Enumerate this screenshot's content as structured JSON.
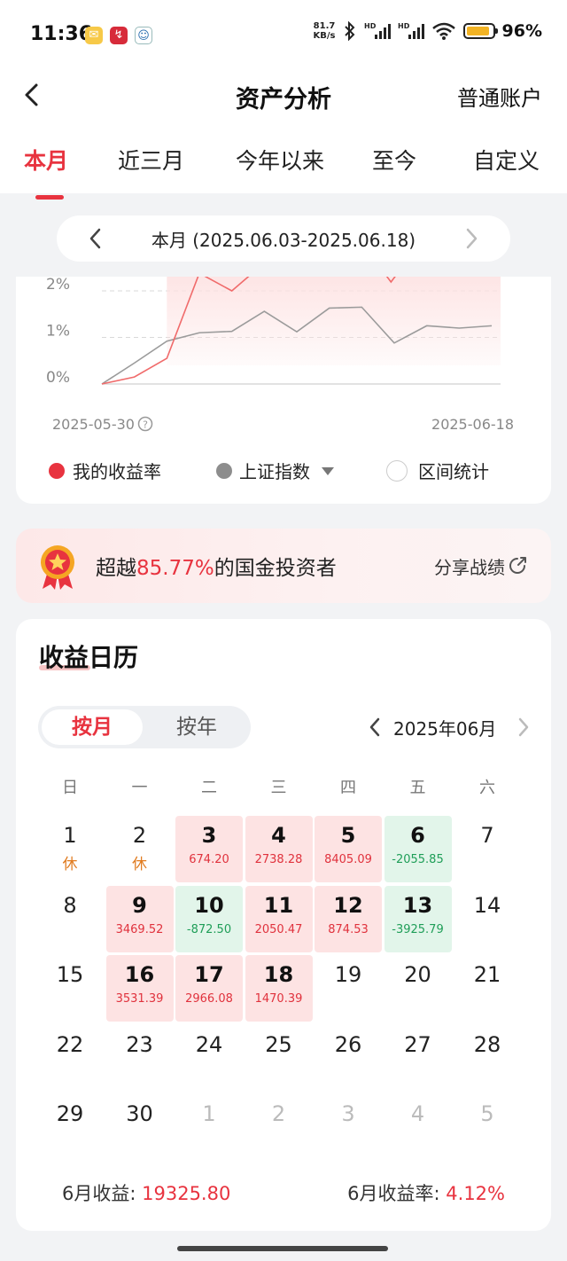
{
  "status_bar": {
    "time": "11:36",
    "net_speed_value": "81.7",
    "net_speed_unit": "KB/s",
    "battery_percent": "96",
    "battery_label": "96%"
  },
  "header": {
    "title": "资产分析",
    "account": "普通账户"
  },
  "tabs": [
    {
      "label": "本月",
      "active": true
    },
    {
      "label": "近三月"
    },
    {
      "label": "今年以来"
    },
    {
      "label": "至今"
    },
    {
      "label": "自定义"
    }
  ],
  "range": {
    "label": "本月 (2025.06.03-2025.06.18)"
  },
  "chart_data": {
    "type": "line",
    "y_ticks": [
      "2%",
      "1%",
      "0%"
    ],
    "x_start_label": "2025-05-30",
    "x_end_label": "2025-06-18",
    "series": [
      {
        "name": "我的收益率",
        "color": "#e8333f",
        "values": [
          0,
          0.15,
          0.55,
          2.38,
          2.0,
          2.6
        ]
      },
      {
        "name": "上证指数",
        "color": "#999999",
        "values": [
          0,
          0.45,
          0.92,
          1.1,
          1.13,
          1.56,
          1.12,
          1.63,
          1.65,
          0.88,
          1.25,
          1.2,
          1.25
        ]
      }
    ],
    "grid": true
  },
  "legend": {
    "mine": "我的收益率",
    "index": "上证指数",
    "stats": "区间统计"
  },
  "beat": {
    "prefix": "超越",
    "percent": "85.77%",
    "suffix": "的国金投资者",
    "share": "分享战绩"
  },
  "calendar": {
    "title": "收益日历",
    "seg_month": "按月",
    "seg_year": "按年",
    "month_label": "2025年06月",
    "weekdays": [
      "日",
      "一",
      "二",
      "三",
      "四",
      "五",
      "六"
    ],
    "cells": [
      {
        "day": "1",
        "sub": "休",
        "kind": "rest"
      },
      {
        "day": "2",
        "sub": "休",
        "kind": "rest"
      },
      {
        "day": "3",
        "sub": "674.20",
        "kind": "up"
      },
      {
        "day": "4",
        "sub": "2738.28",
        "kind": "up"
      },
      {
        "day": "5",
        "sub": "8405.09",
        "kind": "up"
      },
      {
        "day": "6",
        "sub": "-2055.85",
        "kind": "down"
      },
      {
        "day": "7",
        "sub": "",
        "kind": "plain"
      },
      {
        "day": "8",
        "sub": "",
        "kind": "plain"
      },
      {
        "day": "9",
        "sub": "3469.52",
        "kind": "up"
      },
      {
        "day": "10",
        "sub": "-872.50",
        "kind": "down"
      },
      {
        "day": "11",
        "sub": "2050.47",
        "kind": "up"
      },
      {
        "day": "12",
        "sub": "874.53",
        "kind": "up"
      },
      {
        "day": "13",
        "sub": "-3925.79",
        "kind": "down"
      },
      {
        "day": "14",
        "sub": "",
        "kind": "plain"
      },
      {
        "day": "15",
        "sub": "",
        "kind": "plain"
      },
      {
        "day": "16",
        "sub": "3531.39",
        "kind": "up"
      },
      {
        "day": "17",
        "sub": "2966.08",
        "kind": "up"
      },
      {
        "day": "18",
        "sub": "1470.39",
        "kind": "up"
      },
      {
        "day": "19",
        "sub": "",
        "kind": "plain"
      },
      {
        "day": "20",
        "sub": "",
        "kind": "plain"
      },
      {
        "day": "21",
        "sub": "",
        "kind": "plain"
      },
      {
        "day": "22",
        "sub": "",
        "kind": "plain"
      },
      {
        "day": "23",
        "sub": "",
        "kind": "plain"
      },
      {
        "day": "24",
        "sub": "",
        "kind": "plain"
      },
      {
        "day": "25",
        "sub": "",
        "kind": "plain"
      },
      {
        "day": "26",
        "sub": "",
        "kind": "plain"
      },
      {
        "day": "27",
        "sub": "",
        "kind": "plain"
      },
      {
        "day": "28",
        "sub": "",
        "kind": "plain"
      },
      {
        "day": "29",
        "sub": "",
        "kind": "plain"
      },
      {
        "day": "30",
        "sub": "",
        "kind": "plain"
      },
      {
        "day": "1",
        "sub": "",
        "kind": "other"
      },
      {
        "day": "2",
        "sub": "",
        "kind": "other"
      },
      {
        "day": "3",
        "sub": "",
        "kind": "other"
      },
      {
        "day": "4",
        "sub": "",
        "kind": "other"
      },
      {
        "day": "5",
        "sub": "",
        "kind": "other"
      }
    ],
    "footer_income_label": "6月收益:",
    "footer_income_value": "19325.80",
    "footer_rate_label": "6月收益率:",
    "footer_rate_value": "4.12%"
  },
  "colors": {
    "accent": "#e8333f",
    "gain": "#e0323d",
    "loss": "#1f9e58"
  }
}
